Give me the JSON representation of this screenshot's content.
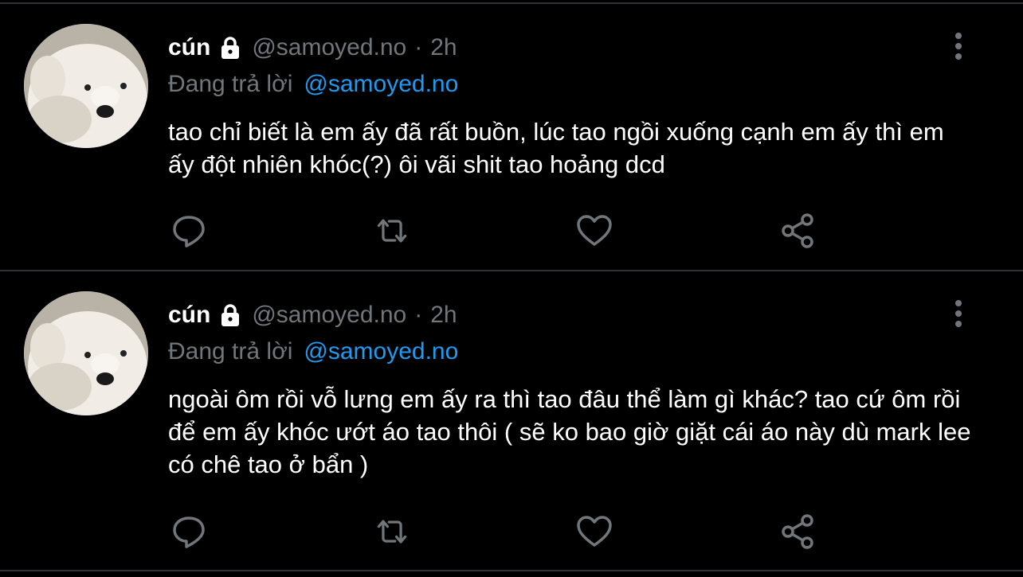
{
  "tweets": [
    {
      "display_name": "cún",
      "handle": "@samoyed.no",
      "separator": "·",
      "time": "2h",
      "reply_prefix": "Đang trả lời",
      "reply_user": "@samoyed.no",
      "text": "tao chỉ biết là em ấy đã rất buồn, lúc tao ngồi xuống cạnh em ấy thì em ấy đột nhiên khóc(?) ôi vãi shit tao hoảng dcd"
    },
    {
      "display_name": "cún",
      "handle": "@samoyed.no",
      "separator": "·",
      "time": "2h",
      "reply_prefix": "Đang trả lời",
      "reply_user": "@samoyed.no",
      "text": "ngoài ôm rồi vỗ lưng em ấy ra thì tao đâu thể làm gì khác? tao cứ ôm rồi để em ấy khóc ướt áo tao thôi ( sẽ ko bao giờ giặt cái áo này dù mark lee có chê tao ở bẩn )"
    }
  ],
  "icons": {
    "lock": "lock-icon",
    "more": "more-vertical-icon",
    "reply": "reply-icon",
    "retweet": "retweet-icon",
    "like": "heart-icon",
    "share": "share-icon"
  },
  "colors": {
    "background": "#000000",
    "text": "#ffffff",
    "secondary": "#71767b",
    "link": "#1d9bf0",
    "divider": "#2f3336"
  }
}
